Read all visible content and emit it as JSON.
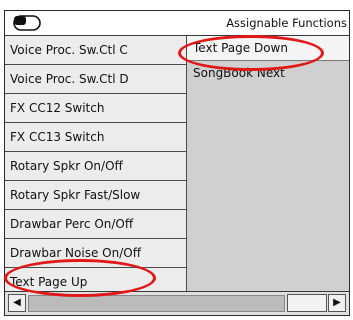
{
  "title": "Assignable Functions",
  "left_items": [
    "Voice Proc. Sw.Ctl C",
    "Voice Proc. Sw.Ctl D",
    "FX CC12 Switch",
    "FX CC13 Switch",
    "Rotary Spkr On/Off",
    "Rotary Spkr Fast/Slow",
    "Drawbar Perc On/Off",
    "Drawbar Noise On/Off",
    "Text Page Up"
  ],
  "right_items": [
    "Text Page Down",
    "SongBook Next"
  ],
  "icons": {
    "title": "cassette-icon",
    "scroll_left": "arrow-left-icon",
    "scroll_right": "arrow-right-icon"
  },
  "highlight_color": "#e01818"
}
